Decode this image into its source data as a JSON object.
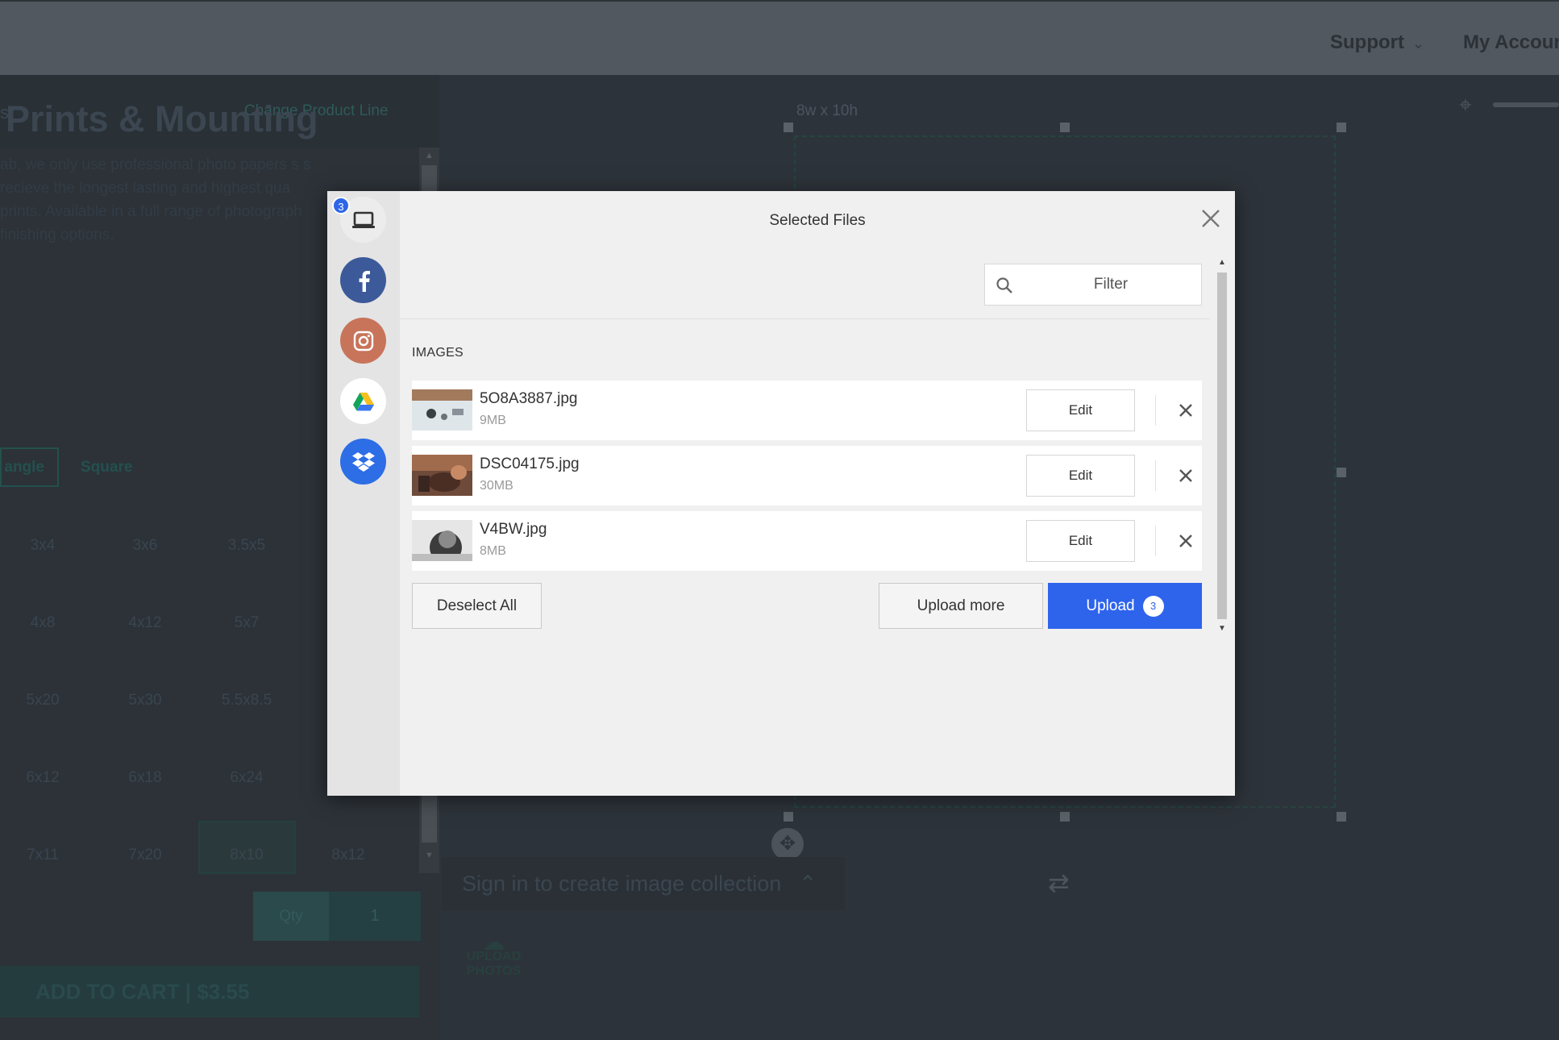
{
  "topbar": {
    "support_label": "Support",
    "account_label": "My Accoun",
    "chevron_glyph": "⌄"
  },
  "left_panel": {
    "header_fragment": "s",
    "change_product_line": "Change Product Line",
    "title": "Prints & Mounting",
    "description": "ab, we only use professional photo papers s s recieve the longest lasting and highest qua prints. Available in a full range of photograph finishing options.",
    "shape_tabs": [
      "angle",
      "Square"
    ],
    "sizes": [
      [
        "3x4",
        "3x6",
        "3.5x5"
      ],
      [
        "4x8",
        "4x12",
        "5x7"
      ],
      [
        "5x20",
        "5x30",
        "5.5x8.5"
      ],
      [
        "6x12",
        "6x18",
        "6x24"
      ],
      [
        "7x11",
        "7x20",
        "8x10",
        "8x12"
      ]
    ],
    "selected_size": "8x10",
    "qty_label": "Qty",
    "qty_value": "1",
    "add_to_cart": "ADD TO CART | $3.55"
  },
  "canvas": {
    "dimension_label": "8w x 10h",
    "signin_label": "Sign in to create image collection",
    "upload_photos_label": "UPLOAD PHOTOS",
    "icons": [
      "target-icon",
      "move-icon",
      "rotate-icon",
      "cloud-upload-icon"
    ]
  },
  "modal": {
    "title": "Selected Files",
    "filter_placeholder": "Filter",
    "section_label": "IMAGES",
    "sources": [
      {
        "name": "My Device",
        "icon": "laptop-icon",
        "badge": "3"
      },
      {
        "name": "Facebook",
        "icon": "facebook-icon"
      },
      {
        "name": "Instagram",
        "icon": "instagram-icon"
      },
      {
        "name": "Google Drive",
        "icon": "google-drive-icon"
      },
      {
        "name": "Dropbox",
        "icon": "dropbox-icon"
      }
    ],
    "files": [
      {
        "name": "5O8A3887.jpg",
        "size": "9MB",
        "edit_label": "Edit"
      },
      {
        "name": "DSC04175.jpg",
        "size": "30MB",
        "edit_label": "Edit"
      },
      {
        "name": "V4BW.jpg",
        "size": "8MB",
        "edit_label": "Edit"
      }
    ],
    "deselect_all": "Deselect All",
    "upload_more": "Upload more",
    "upload_label": "Upload",
    "upload_count": "3"
  },
  "colors": {
    "accent": "#2e64ec",
    "overlay_bg": "#2b3138",
    "facebook": "#3c5a99",
    "instagram": "#c8745a",
    "dropbox": "#2d6de6"
  }
}
